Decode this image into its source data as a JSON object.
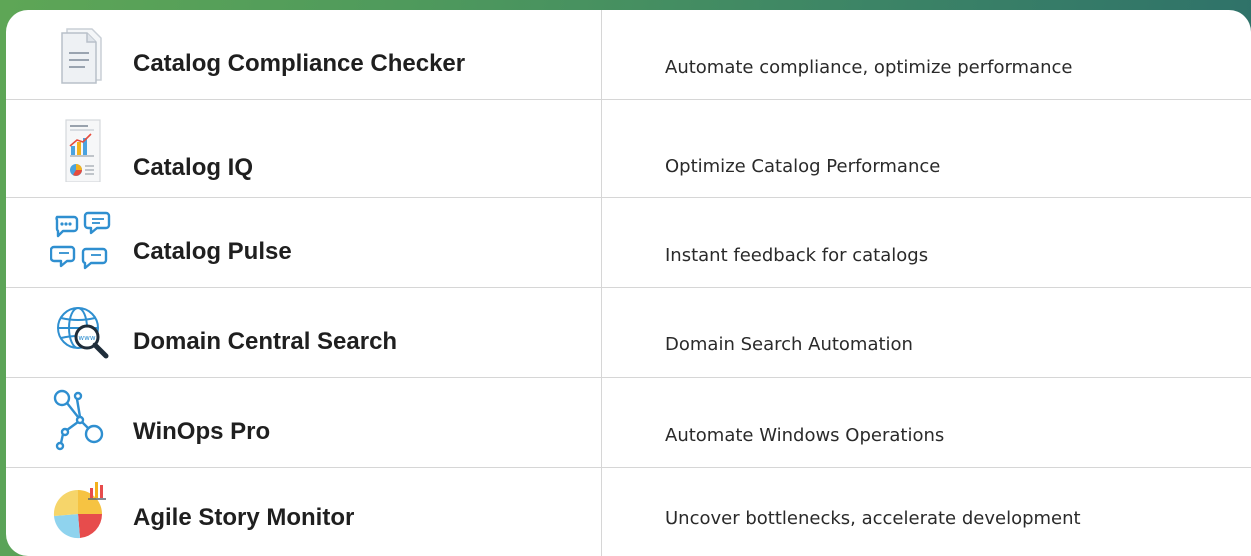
{
  "products": [
    {
      "name": "Catalog Compliance Checker",
      "description": "Automate compliance, optimize performance",
      "icon": "document-icon"
    },
    {
      "name": "Catalog IQ",
      "description": "Optimize Catalog Performance",
      "icon": "report-chart-icon"
    },
    {
      "name": "Catalog Pulse",
      "description": "Instant feedback for catalogs",
      "icon": "chat-bubbles-icon"
    },
    {
      "name": "Domain Central Search",
      "description": "Domain Search Automation",
      "icon": "globe-search-icon"
    },
    {
      "name": "WinOps Pro",
      "description": "Automate Windows Operations",
      "icon": "network-nodes-icon"
    },
    {
      "name": "Agile Story Monitor",
      "description": "Uncover bottlenecks, accelerate development",
      "icon": "pie-chart-icon"
    }
  ],
  "colors": {
    "background_gradient_start": "#5ea656",
    "background_gradient_end": "#2c6e6a",
    "card": "#ffffff",
    "divider": "#d6d6d6",
    "icon_blue": "#2f8fd0"
  }
}
